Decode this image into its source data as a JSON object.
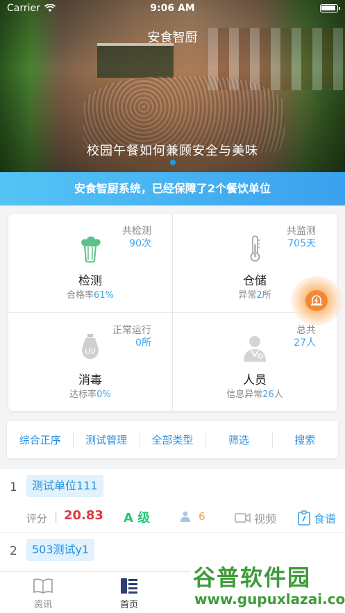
{
  "status_bar": {
    "carrier": "Carrier",
    "time": "9:06 AM"
  },
  "header": {
    "title": "安食智厨"
  },
  "banner": {
    "caption": "校园午餐如何兼顾安全与美味"
  },
  "notice": {
    "text": "安食智厨系统，已经保障了2个餐饮单位"
  },
  "stats": {
    "detect": {
      "meta_label": "共检测",
      "meta_value": "90",
      "meta_unit": "次",
      "title": "检测",
      "sub_label": "合格率",
      "sub_value": "61%",
      "sub_unit": "",
      "icon": "vegetable-icon"
    },
    "storage": {
      "meta_label": "共监测",
      "meta_value": "705",
      "meta_unit": "天",
      "title": "仓储",
      "sub_label": "异常",
      "sub_value": "2",
      "sub_unit": "所",
      "icon": "thermometer-icon"
    },
    "disinfect": {
      "meta_label": "正常运行",
      "meta_value": "0",
      "meta_unit": "所",
      "title": "消毒",
      "sub_label": "达标率",
      "sub_value": "0%",
      "sub_unit": "",
      "icon": "uv-lamp-icon",
      "icon_text": "UV"
    },
    "staff": {
      "meta_label": "总共",
      "meta_value": "27",
      "meta_unit": "人",
      "title": "人员",
      "sub_label": "信息异常",
      "sub_value": "26",
      "sub_unit": "人",
      "icon": "doctor-icon"
    }
  },
  "filters": [
    "综合正序",
    "测试管理",
    "全部类型",
    "筛选",
    "搜索"
  ],
  "list": [
    {
      "index": "1",
      "name": "测试单位111",
      "score_label": "评分",
      "separator": "|",
      "score": "20.83",
      "grade": "A 级",
      "staff_count": "6",
      "video_label": "视频",
      "recipe_label": "食谱"
    },
    {
      "index": "2",
      "name": "503测试y1"
    }
  ],
  "tabbar": {
    "news": "资讯",
    "home": "首页"
  },
  "watermark": {
    "title": "谷普软件园",
    "url": "www.gupuxlazai.com"
  },
  "colors": {
    "accent": "#3fa3ea",
    "notice_bg": "#3aa1ee",
    "score": "#e0383e",
    "grade": "#2bc67a",
    "staff": "#f0a041",
    "alarm": "#f08a36"
  }
}
